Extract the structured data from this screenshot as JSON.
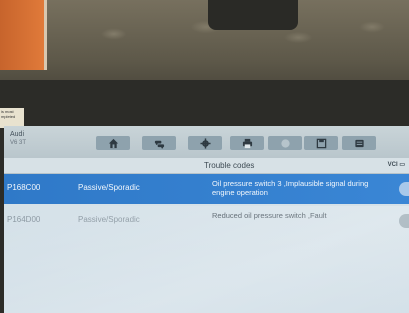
{
  "vehicle": {
    "make": "Audi",
    "model": "V6 3T"
  },
  "sticker": {
    "line1": "is most",
    "line2": "mpleted"
  },
  "toolbar": {
    "buttons": [
      {
        "name": "home",
        "icon": "home-icon"
      },
      {
        "name": "vehicle-swap",
        "icon": "car-swap-icon"
      },
      {
        "name": "settings",
        "icon": "gear-icon"
      },
      {
        "name": "print",
        "icon": "printer-icon"
      },
      {
        "name": "help",
        "icon": "help-icon"
      },
      {
        "name": "save",
        "icon": "save-icon"
      },
      {
        "name": "data-logging",
        "icon": "log-icon"
      }
    ]
  },
  "page": {
    "title": "Trouble codes",
    "vci": "VCI"
  },
  "dtcs": [
    {
      "code": "P168C00",
      "status": "Passive/Sporadic",
      "description": "Oil pressure switch 3 ,Implausible signal during engine operation",
      "selected": true
    },
    {
      "code": "P164D00",
      "status": "Passive/Sporadic",
      "description": "Reduced oil pressure switch ,Fault",
      "selected": false
    }
  ],
  "colors": {
    "selected_row": "#2f79c8",
    "toolbar": "#8ea2ad",
    "screen_bg": "#d9e4ea"
  }
}
